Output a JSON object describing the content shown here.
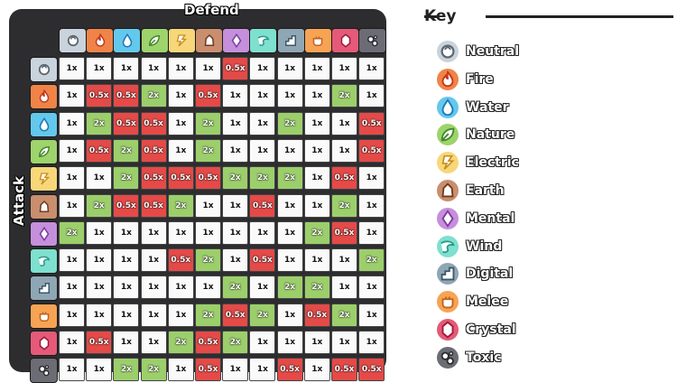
{
  "axes": {
    "defend": "Defend",
    "attack": "Attack"
  },
  "key": {
    "title": "Key"
  },
  "types": [
    {
      "id": "neutral",
      "name": "Neutral",
      "icon": "neutral-icon",
      "color": "#c9d3dc",
      "dark": "#5b6670"
    },
    {
      "id": "fire",
      "name": "Fire",
      "icon": "fire-icon",
      "color": "#f08448",
      "dark": "#c23a1c"
    },
    {
      "id": "water",
      "name": "Water",
      "icon": "water-icon",
      "color": "#63c8ec",
      "dark": "#1c78b8"
    },
    {
      "id": "nature",
      "name": "Nature",
      "icon": "nature-icon",
      "color": "#9fd36c",
      "dark": "#3f8a2a"
    },
    {
      "id": "electric",
      "name": "Electric",
      "icon": "electric-icon",
      "color": "#f7d779",
      "dark": "#c98e1e"
    },
    {
      "id": "earth",
      "name": "Earth",
      "icon": "earth-icon",
      "color": "#c98e6d",
      "dark": "#6e3a22"
    },
    {
      "id": "mental",
      "name": "Mental",
      "icon": "mental-icon",
      "color": "#c58fdc",
      "dark": "#7a3aa0"
    },
    {
      "id": "wind",
      "name": "Wind",
      "icon": "wind-icon",
      "color": "#7ee0cf",
      "dark": "#2a9a8a"
    },
    {
      "id": "digital",
      "name": "Digital",
      "icon": "digital-icon",
      "color": "#8fa6b4",
      "dark": "#3c5868"
    },
    {
      "id": "melee",
      "name": "Melee",
      "icon": "melee-icon",
      "color": "#f7a354",
      "dark": "#c0621c"
    },
    {
      "id": "crystal",
      "name": "Crystal",
      "icon": "crystal-icon",
      "color": "#e45a78",
      "dark": "#a01838"
    },
    {
      "id": "toxic",
      "name": "Toxic",
      "icon": "toxic-icon",
      "color": "#6c6c74",
      "dark": "#2a2a30"
    }
  ],
  "matrix": [
    [
      "1x",
      "1x",
      "1x",
      "1x",
      "1x",
      "1x",
      "0.5x",
      "1x",
      "1x",
      "1x",
      "1x",
      "1x"
    ],
    [
      "1x",
      "0.5x",
      "0.5x",
      "2x",
      "1x",
      "0.5x",
      "1x",
      "1x",
      "1x",
      "1x",
      "2x",
      "1x"
    ],
    [
      "1x",
      "2x",
      "0.5x",
      "0.5x",
      "1x",
      "2x",
      "1x",
      "1x",
      "2x",
      "1x",
      "1x",
      "0.5x"
    ],
    [
      "1x",
      "0.5x",
      "2x",
      "0.5x",
      "1x",
      "2x",
      "1x",
      "1x",
      "1x",
      "1x",
      "1x",
      "0.5x"
    ],
    [
      "1x",
      "1x",
      "2x",
      "0.5x",
      "0.5x",
      "0.5x",
      "2x",
      "2x",
      "2x",
      "1x",
      "0.5x",
      "1x"
    ],
    [
      "1x",
      "2x",
      "0.5x",
      "0.5x",
      "2x",
      "1x",
      "1x",
      "0.5x",
      "1x",
      "1x",
      "2x",
      "1x"
    ],
    [
      "2x",
      "1x",
      "1x",
      "1x",
      "1x",
      "1x",
      "1x",
      "1x",
      "1x",
      "2x",
      "0.5x",
      "1x"
    ],
    [
      "1x",
      "1x",
      "1x",
      "1x",
      "0.5x",
      "2x",
      "1x",
      "0.5x",
      "1x",
      "1x",
      "1x",
      "2x"
    ],
    [
      "1x",
      "1x",
      "1x",
      "1x",
      "1x",
      "1x",
      "2x",
      "1x",
      "2x",
      "2x",
      "1x",
      "1x"
    ],
    [
      "1x",
      "1x",
      "1x",
      "1x",
      "1x",
      "2x",
      "0.5x",
      "2x",
      "1x",
      "0.5x",
      "2x",
      "1x"
    ],
    [
      "1x",
      "0.5x",
      "1x",
      "1x",
      "2x",
      "0.5x",
      "2x",
      "1x",
      "1x",
      "1x",
      "1x",
      "1x"
    ],
    [
      "1x",
      "1x",
      "2x",
      "2x",
      "1x",
      "0.5x",
      "1x",
      "1x",
      "0.5x",
      "1x",
      "0.5x",
      "0.5x"
    ]
  ]
}
